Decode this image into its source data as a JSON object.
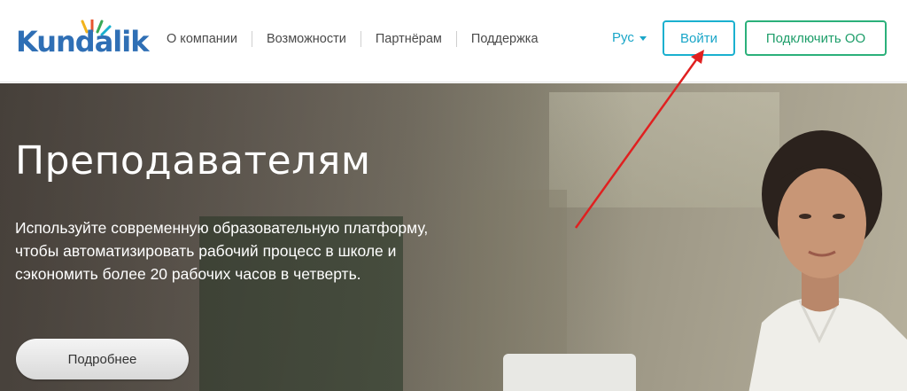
{
  "header": {
    "logo_text": "Kundalik",
    "nav": [
      {
        "label": "О компании"
      },
      {
        "label": "Возможности"
      },
      {
        "label": "Партнёрам"
      },
      {
        "label": "Поддержка"
      }
    ],
    "language": "Рус",
    "login_label": "Войти",
    "connect_label": "Подключить ОО"
  },
  "hero": {
    "title": "Преподавателям",
    "lines": [
      "Используйте современную образовательную платформу,",
      "чтобы автоматизировать рабочий процесс в школе и",
      "сэкономить более 20 рабочих часов в четверть."
    ],
    "more_label": "Подробнее"
  },
  "colors": {
    "brand_blue": "#2f6fb5",
    "accent_cyan": "#1aa6c8",
    "accent_green": "#2bb07a",
    "annotation_red": "#e02020"
  },
  "icons": {
    "lang_caret": "chevron-down-icon",
    "annotation": "arrow-icon"
  }
}
